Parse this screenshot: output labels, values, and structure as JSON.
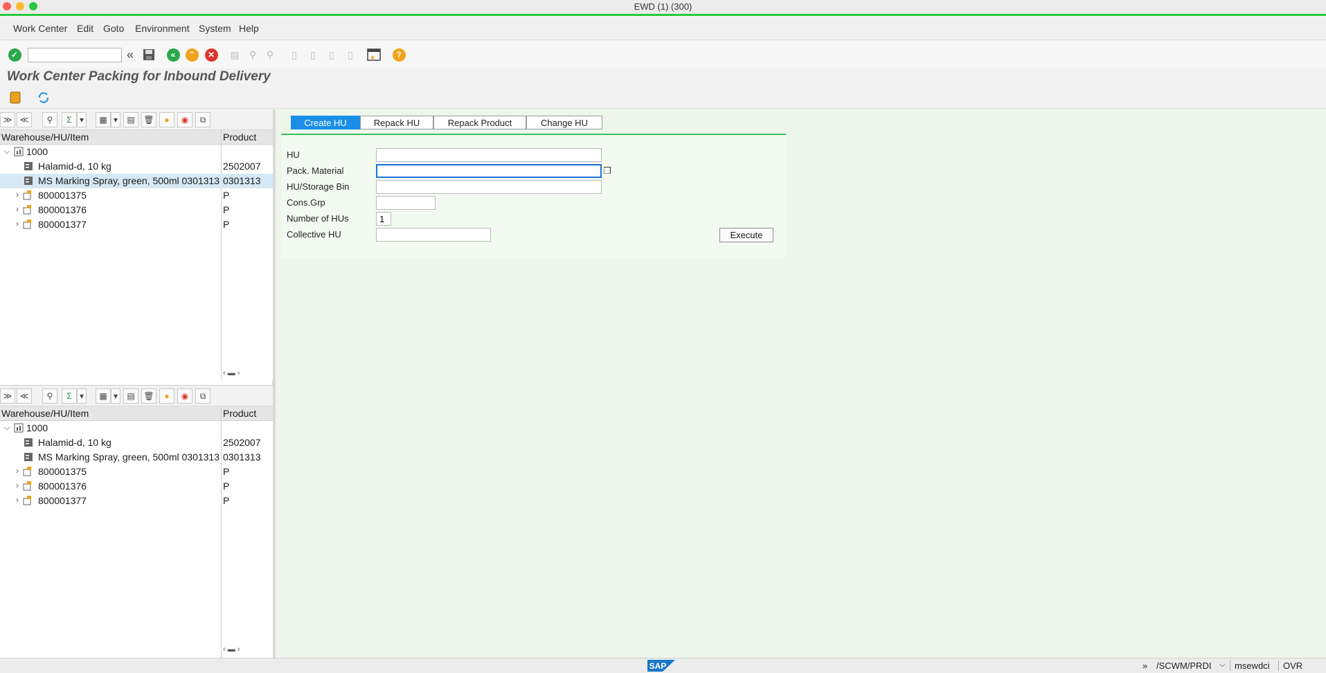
{
  "window": {
    "title": "EWD (1) (300)"
  },
  "menu": [
    "Work Center",
    "Edit",
    "Goto",
    "Environment",
    "System",
    "Help"
  ],
  "toolbar": {
    "command_value": ""
  },
  "page": {
    "title": "Work Center Packing for Inbound Delivery"
  },
  "tree_top": {
    "col_item": "Warehouse/HU/Item",
    "col_product": "Product",
    "rows": [
      {
        "label": "1000",
        "product": ""
      },
      {
        "label": "Halamid-d, 10 kg",
        "product": "2502007"
      },
      {
        "label": "MS Marking Spray, green, 500ml 0301313",
        "product": "0301313"
      },
      {
        "label": "800001375",
        "product": "P"
      },
      {
        "label": "800001376",
        "product": "P"
      },
      {
        "label": "800001377",
        "product": "P"
      }
    ]
  },
  "tree_bottom": {
    "col_item": "Warehouse/HU/Item",
    "col_product": "Product",
    "rows": [
      {
        "label": "1000",
        "product": ""
      },
      {
        "label": "Halamid-d, 10 kg",
        "product": "2502007"
      },
      {
        "label": "MS Marking Spray, green, 500ml 0301313",
        "product": "0301313"
      },
      {
        "label": "800001375",
        "product": "P"
      },
      {
        "label": "800001376",
        "product": "P"
      },
      {
        "label": "800001377",
        "product": "P"
      }
    ]
  },
  "tabs": [
    "Create HU",
    "Repack HU",
    "Repack Product",
    "Change HU"
  ],
  "form": {
    "hu_label": "HU",
    "hu_value": "",
    "pack_label": "Pack. Material",
    "pack_value": "",
    "bin_label": "HU/Storage Bin",
    "bin_value": "",
    "cons_label": "Cons.Grp",
    "cons_value": "",
    "num_label": "Number of HUs",
    "num_value": "1",
    "coll_label": "Collective HU",
    "coll_value": "",
    "execute_label": "Execute"
  },
  "status": {
    "logo": "SAP",
    "arrows": "»",
    "transaction": "/SCWM/PRDI",
    "server": "msewdci",
    "mode": "OVR"
  },
  "colors": {
    "accent": "#1b8ee8",
    "green_line": "#27c93f",
    "panel_bg": "#eef6ec"
  }
}
